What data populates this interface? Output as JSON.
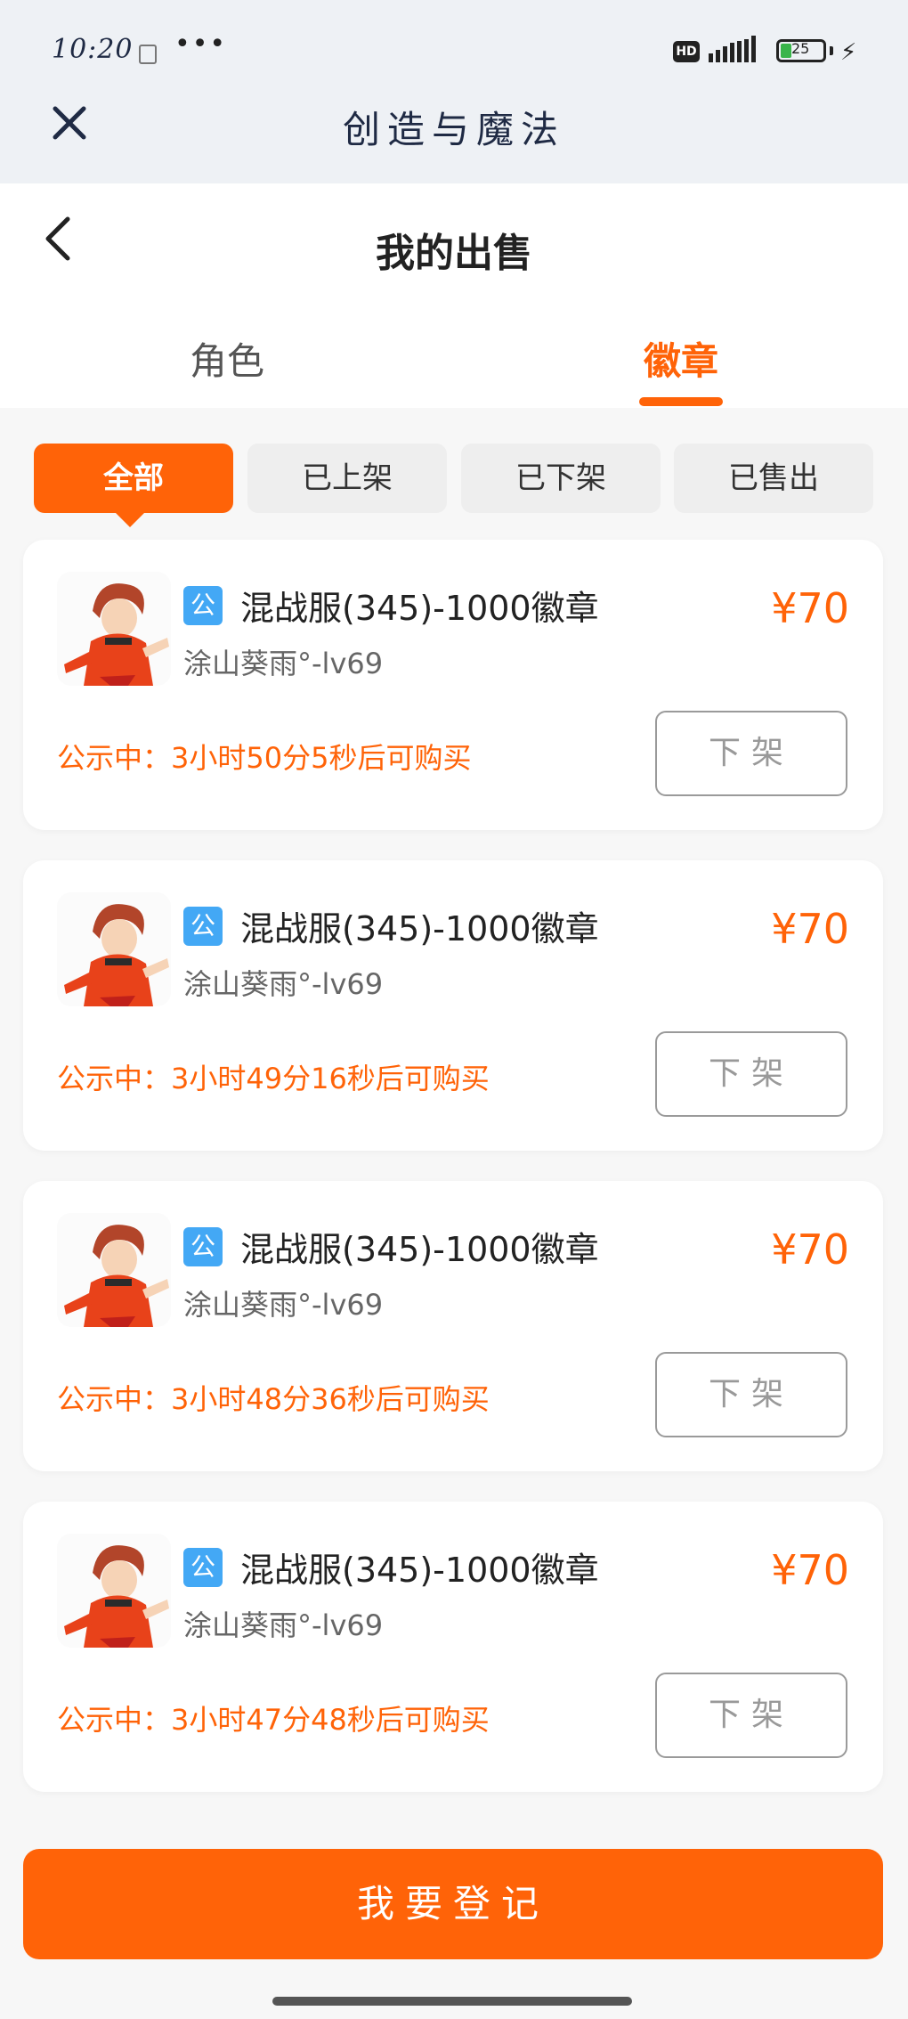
{
  "status_bar": {
    "time": "10:20",
    "more": "•••",
    "hd": "HD",
    "battery": "25"
  },
  "app_bar": {
    "title": "创造与魔法"
  },
  "page": {
    "title": "我的出售"
  },
  "tabs": [
    {
      "label": "角色",
      "active": false
    },
    {
      "label": "徽章",
      "active": true
    }
  ],
  "filters": [
    {
      "label": "全部",
      "active": true
    },
    {
      "label": "已上架",
      "active": false
    },
    {
      "label": "已下架",
      "active": false
    },
    {
      "label": "已售出",
      "active": false
    }
  ],
  "listings": [
    {
      "tag": "公",
      "title": "混战服(345)-1000徽章",
      "seller": "涂山葵雨°-lv69",
      "price": "¥70",
      "notice": "公示中：3小时50分5秒后可购买",
      "button": "下架"
    },
    {
      "tag": "公",
      "title": "混战服(345)-1000徽章",
      "seller": "涂山葵雨°-lv69",
      "price": "¥70",
      "notice": "公示中：3小时49分16秒后可购买",
      "button": "下架"
    },
    {
      "tag": "公",
      "title": "混战服(345)-1000徽章",
      "seller": "涂山葵雨°-lv69",
      "price": "¥70",
      "notice": "公示中：3小时48分36秒后可购买",
      "button": "下架"
    },
    {
      "tag": "公",
      "title": "混战服(345)-1000徽章",
      "seller": "涂山葵雨°-lv69",
      "price": "¥70",
      "notice": "公示中：3小时47分48秒后可购买",
      "button": "下架"
    }
  ],
  "bottom": {
    "register_label": "我要登记"
  },
  "colors": {
    "accent": "#ff6308",
    "tag_blue": "#43a8f5",
    "header_bg": "#eef1f5"
  },
  "icons": {
    "close": "close-icon",
    "back": "chevron-left-icon",
    "avatar": "character-avatar"
  }
}
